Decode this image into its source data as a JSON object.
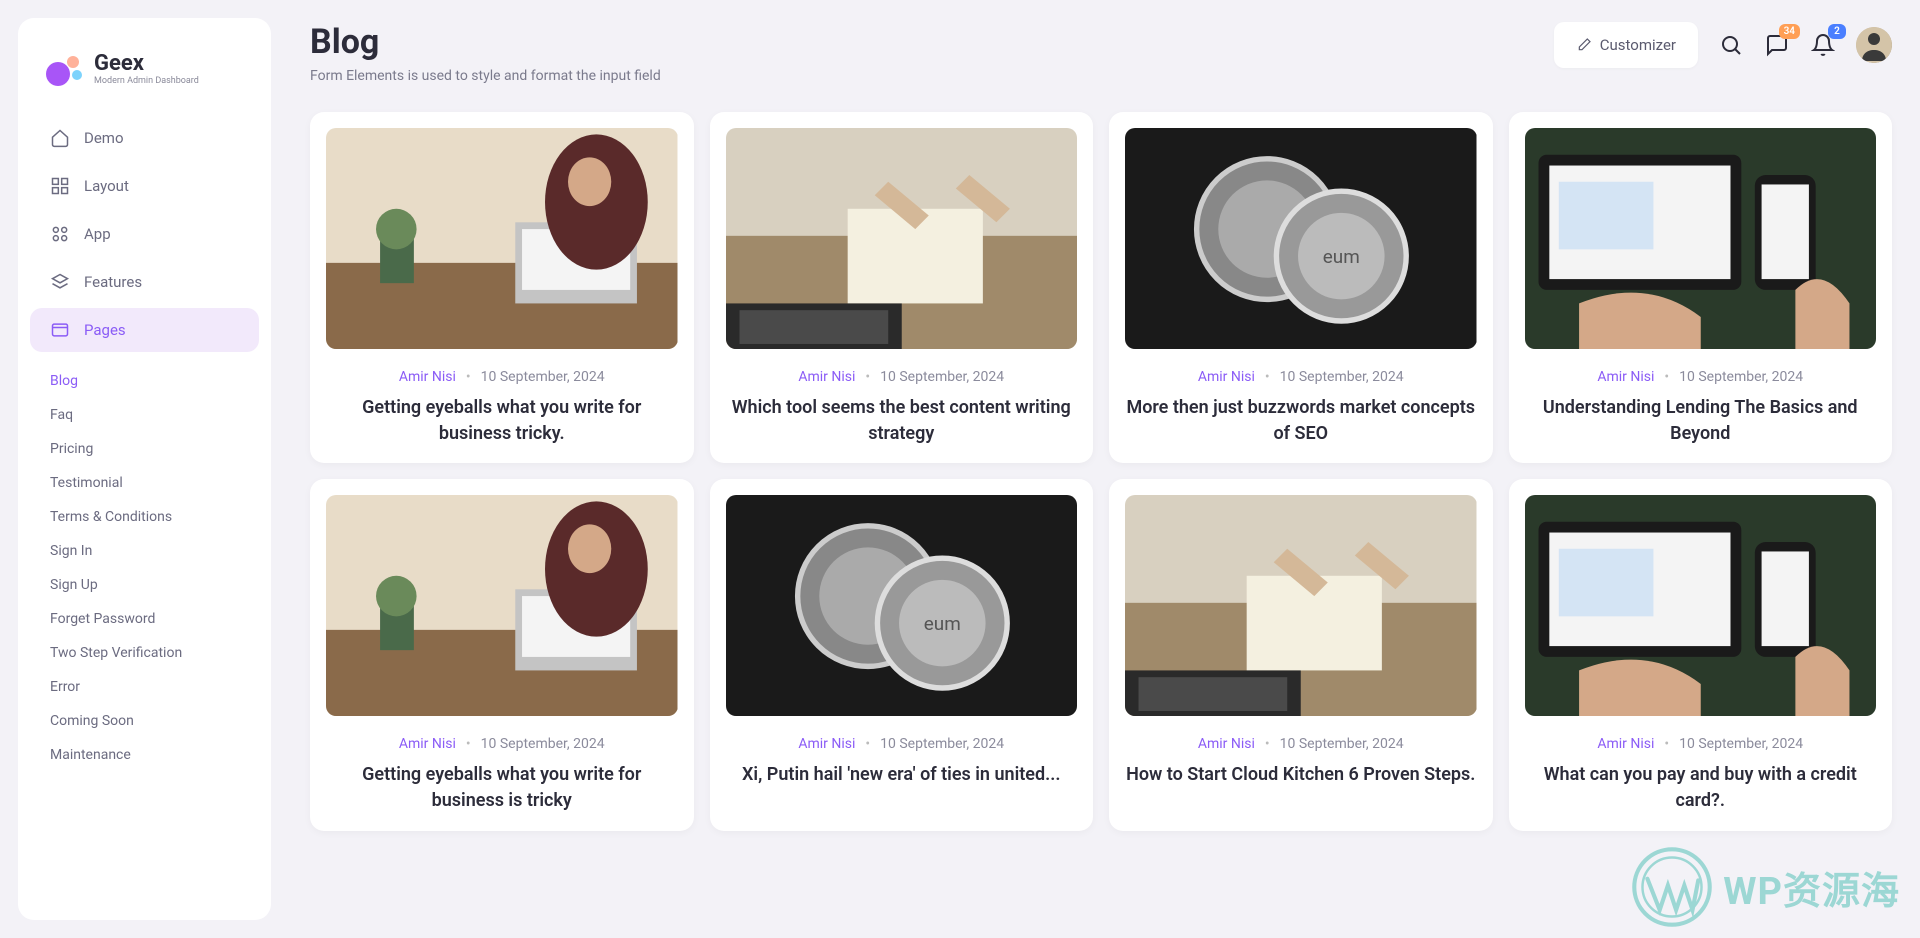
{
  "brand": {
    "title": "Geex",
    "subtitle": "Modern Admin Dashboard"
  },
  "sidebar": {
    "items": [
      {
        "label": "Demo"
      },
      {
        "label": "Layout"
      },
      {
        "label": "App"
      },
      {
        "label": "Features"
      },
      {
        "label": "Pages"
      }
    ],
    "subnav": [
      {
        "label": "Blog"
      },
      {
        "label": "Faq"
      },
      {
        "label": "Pricing"
      },
      {
        "label": "Testimonial"
      },
      {
        "label": "Terms & Conditions"
      },
      {
        "label": "Sign In"
      },
      {
        "label": "Sign Up"
      },
      {
        "label": "Forget Password"
      },
      {
        "label": "Two Step Verification"
      },
      {
        "label": "Error"
      },
      {
        "label": "Coming Soon"
      },
      {
        "label": "Maintenance"
      }
    ]
  },
  "header": {
    "title": "Blog",
    "subtitle": "Form Elements is used to style and format the input field",
    "customizer": "Customizer",
    "chat_badge": "34",
    "notif_badge": "2"
  },
  "posts": [
    {
      "author": "Amir Nisi",
      "date": "10 September, 2024",
      "title": "Getting eyeballs what you write for business tricky."
    },
    {
      "author": "Amir Nisi",
      "date": "10 September, 2024",
      "title": "Which tool seems the best content writing strategy"
    },
    {
      "author": "Amir Nisi",
      "date": "10 September, 2024",
      "title": "More then just buzzwords market concepts of SEO"
    },
    {
      "author": "Amir Nisi",
      "date": "10 September, 2024",
      "title": "Understanding Lending The Basics and Beyond"
    },
    {
      "author": "Amir Nisi",
      "date": "10 September, 2024",
      "title": "Getting eyeballs what you write for business is tricky"
    },
    {
      "author": "Amir Nisi",
      "date": "10 September, 2024",
      "title": "Xi, Putin hail 'new era' of ties in united..."
    },
    {
      "author": "Amir Nisi",
      "date": "10 September, 2024",
      "title": "How to Start Cloud Kitchen 6 Proven Steps."
    },
    {
      "author": "Amir Nisi",
      "date": "10 September, 2024",
      "title": "What can you pay and buy with a credit card?."
    }
  ],
  "watermark": "WP资源海"
}
